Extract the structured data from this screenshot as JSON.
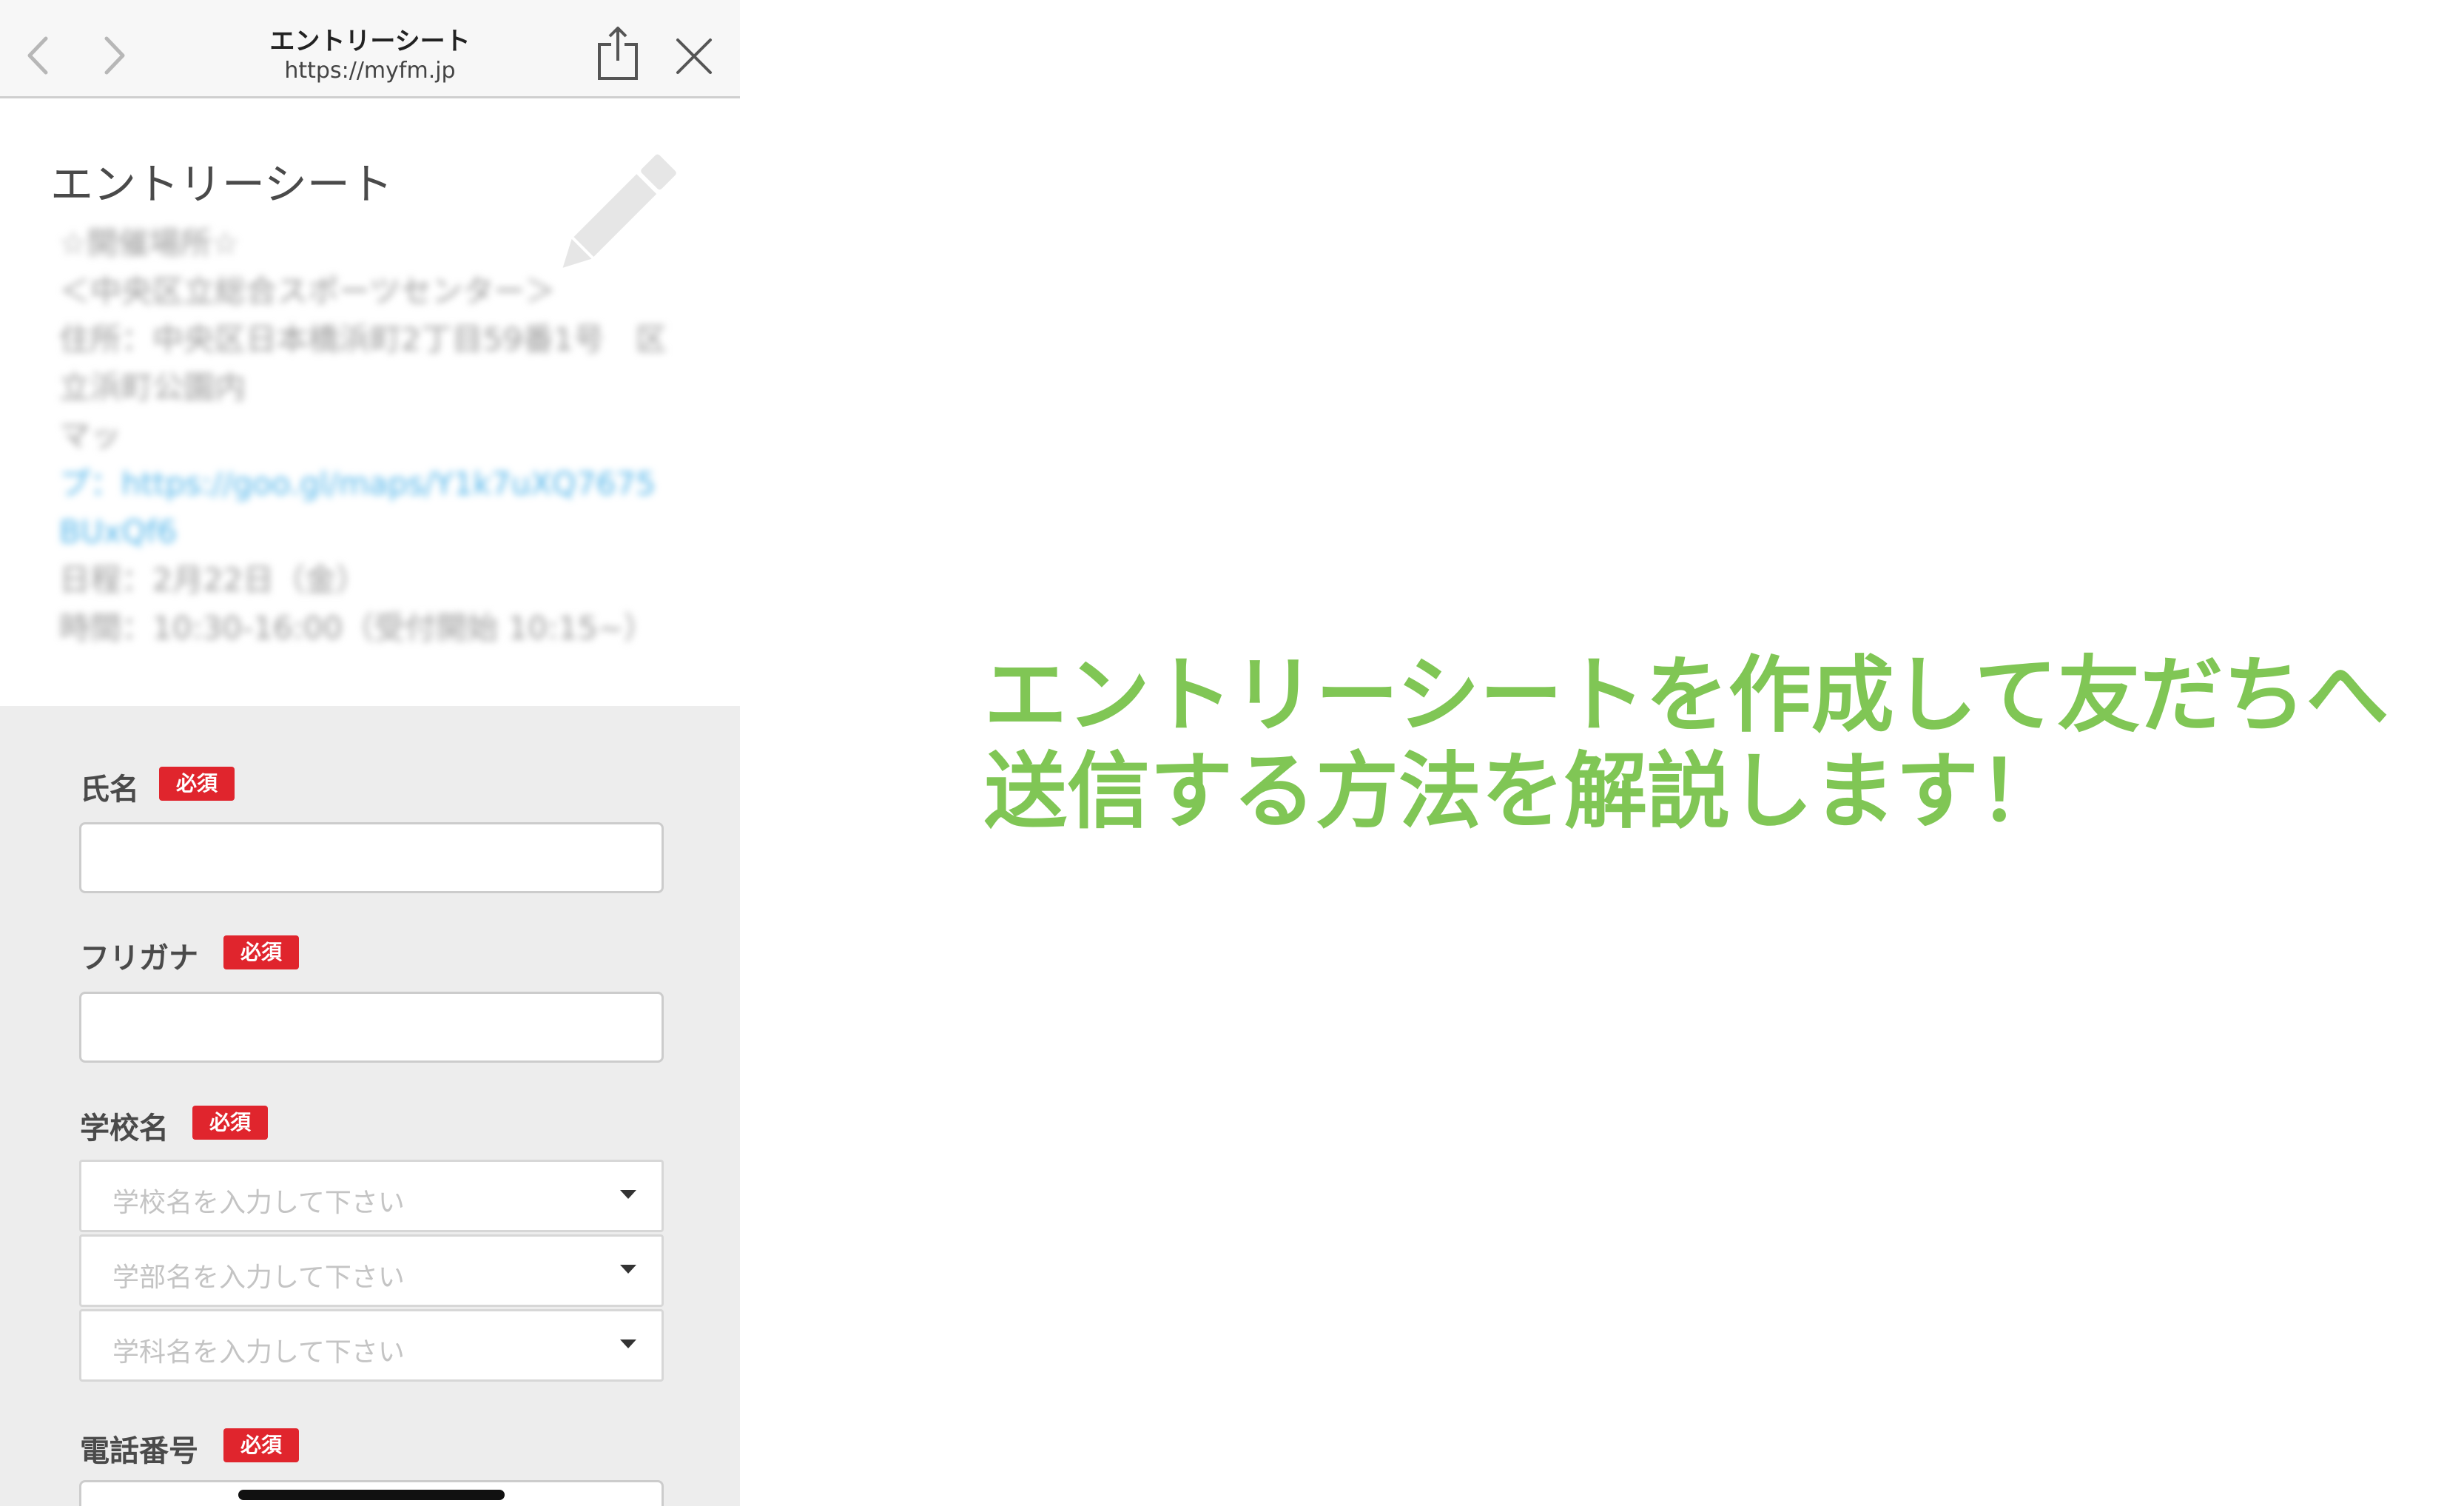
{
  "browser": {
    "title": "エントリーシート",
    "url": "https://myfm.jp"
  },
  "sheet": {
    "title": "エントリーシート",
    "description_lines": [
      "☆開催場所☆",
      "＜中央区立総合スポーツセンター＞",
      "住所：中央区日本橋浜町2丁目59番1号　区",
      "立浜町公園内",
      "マッ",
      "プ：https://goo.gl/maps/Y1k7uXQ7675",
      "BUxQf6",
      "日程：2月22日（金）",
      "時間：10:30-16:00（受付開始 10:15~）"
    ]
  },
  "form": {
    "required_badge": "必須",
    "fields": [
      {
        "label": "氏名"
      },
      {
        "label": "フリガナ"
      },
      {
        "label": "学校名"
      },
      {
        "label": "電話番号"
      }
    ],
    "school_selects": [
      {
        "placeholder": "学校名を入力して下さい"
      },
      {
        "placeholder": "学部名を入力して下さい"
      },
      {
        "placeholder": "学科名を入力して下さい"
      }
    ]
  },
  "headline": {
    "line1": "エントリーシートを作成して友だちへ",
    "line2": "送信する方法を解説します！"
  },
  "colors": {
    "accent_green": "#80c655",
    "required_red": "#e0252d",
    "link_blue": "#55b6ea",
    "form_bg": "#ededed"
  },
  "icons": [
    "chevron-left-icon",
    "chevron-right-icon",
    "share-icon",
    "close-icon",
    "pencil-icon",
    "dropdown-caret-icon"
  ]
}
